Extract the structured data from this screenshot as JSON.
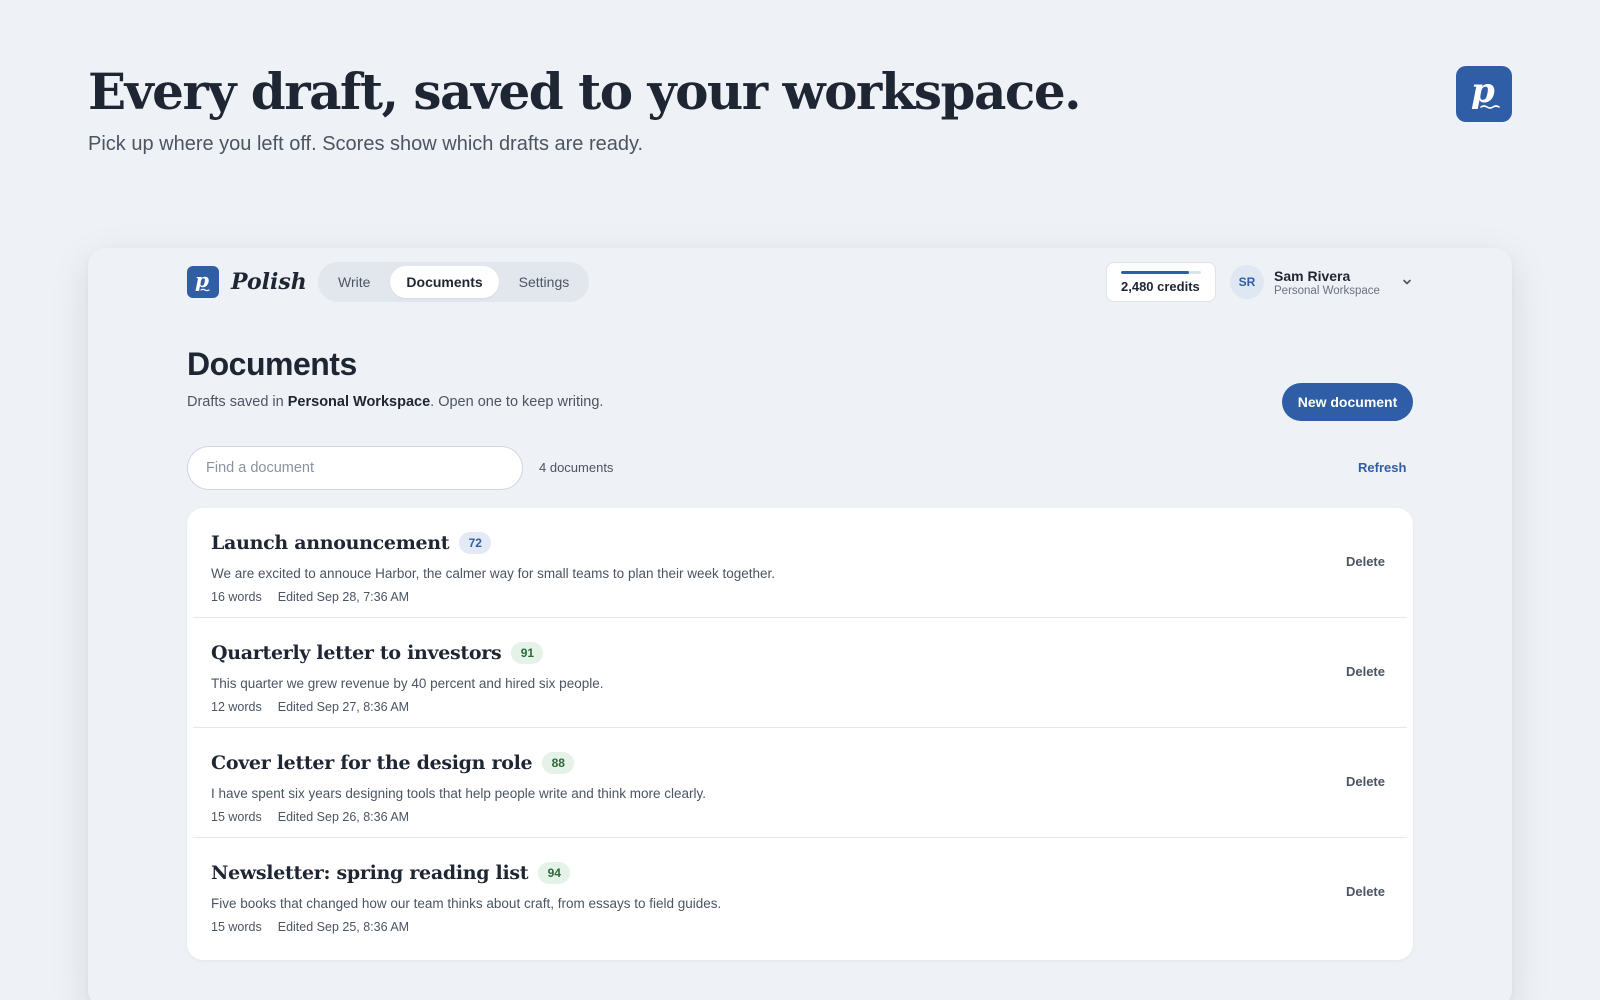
{
  "hero": {
    "title": "Every draft, saved to your workspace.",
    "subtitle": "Pick up where you left off. Scores show which drafts are ready.",
    "logo_icon": "polish-logo-icon"
  },
  "app": {
    "brand_name": "Polish",
    "nav": [
      {
        "label": "Write",
        "active": false
      },
      {
        "label": "Documents",
        "active": true
      },
      {
        "label": "Settings",
        "active": false
      }
    ],
    "credits": {
      "label": "2,480 credits",
      "fill_fraction": 0.85
    },
    "user": {
      "initials": "SR",
      "name": "Sam Rivera",
      "workspace": "Personal Workspace"
    },
    "page": {
      "title": "Documents",
      "subtitle_prefix": "Drafts saved in ",
      "subtitle_workspace": "Personal Workspace",
      "subtitle_suffix": ". Open one to keep writing.",
      "new_button": "New document",
      "search_placeholder": "Find a document",
      "count": "4 documents",
      "refresh": "Refresh"
    },
    "documents": [
      {
        "title": "Launch announcement",
        "score": "72",
        "excerpt": "We are excited to annouce Harbor, the calmer way for small teams to plan their week together.",
        "words": "16 words",
        "edited": "Edited Sep 28, 7:36 AM",
        "delete": "Delete"
      },
      {
        "title": "Quarterly letter to investors",
        "score": "91",
        "excerpt": "This quarter we grew revenue by 40 percent and hired six people.",
        "words": "12 words",
        "edited": "Edited Sep 27, 8:36 AM",
        "delete": "Delete"
      },
      {
        "title": "Cover letter for the design role",
        "score": "88",
        "excerpt": "I have spent six years designing tools that help people write and think more clearly.",
        "words": "15 words",
        "edited": "Edited Sep 26, 8:36 AM",
        "delete": "Delete"
      },
      {
        "title": "Newsletter: spring reading list",
        "score": "94",
        "excerpt": "Five books that changed how our team thinks about craft, from essays to field guides.",
        "words": "15 words",
        "edited": "Edited Sep 25, 8:36 AM",
        "delete": "Delete"
      }
    ]
  },
  "colors": {
    "accent": "#2f5ea6",
    "background": "#eef1f5",
    "score_mid_bg": "#e3eaf6",
    "score_high_bg": "#e4f2e7"
  }
}
